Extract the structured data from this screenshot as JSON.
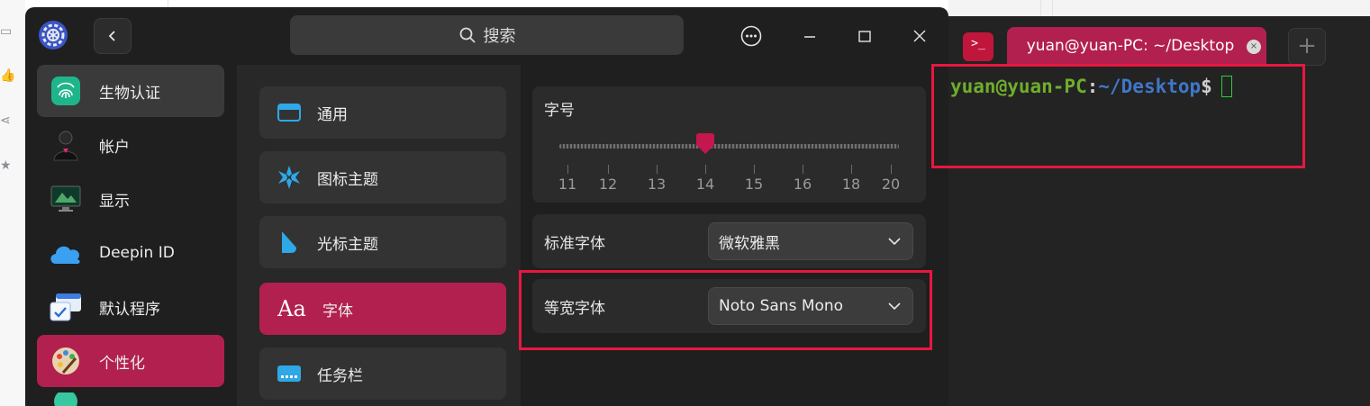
{
  "control_center": {
    "search": {
      "placeholder": "搜索"
    },
    "sidebar": {
      "items": [
        {
          "label": "生物认证",
          "icon": "fingerprint-icon",
          "state": "hover"
        },
        {
          "label": "帐户",
          "icon": "user-avatar-icon",
          "state": "normal"
        },
        {
          "label": "显示",
          "icon": "display-icon",
          "state": "normal"
        },
        {
          "label": "Deepin ID",
          "icon": "cloud-icon",
          "state": "normal"
        },
        {
          "label": "默认程序",
          "icon": "default-apps-icon",
          "state": "normal"
        },
        {
          "label": "个性化",
          "icon": "palette-icon",
          "state": "active"
        }
      ]
    },
    "personalization": {
      "items": [
        {
          "label": "通用",
          "icon": "window-icon"
        },
        {
          "label": "图标主题",
          "icon": "icon-theme-icon"
        },
        {
          "label": "光标主题",
          "icon": "cursor-theme-icon"
        },
        {
          "label": "字体",
          "icon": "font-icon",
          "icon_text": "Aa",
          "active": true
        },
        {
          "label": "任务栏",
          "icon": "dock-icon"
        }
      ]
    },
    "font_settings": {
      "size": {
        "label": "字号",
        "value": 14,
        "ticks": [
          "11",
          "12",
          "13",
          "14",
          "15",
          "16",
          "18",
          "20"
        ]
      },
      "standard_font": {
        "label": "标准字体",
        "value": "微软雅黑"
      },
      "monospace_font": {
        "label": "等宽字体",
        "value": "Noto Sans Mono"
      }
    }
  },
  "terminal": {
    "tab_title": "yuan@yuan-PC: ~/Desktop",
    "prompt": {
      "user_host": "yuan@yuan-PC",
      "colon": ":",
      "path": "~/Desktop",
      "symbol": "$"
    },
    "icon_glyph": ">_"
  },
  "colors": {
    "accent": "#b2204f",
    "highlight_box": "#e8173f",
    "window_bg": "#1f1f1f",
    "terminal_user": "#6fae2c",
    "terminal_path": "#3f77c9"
  }
}
